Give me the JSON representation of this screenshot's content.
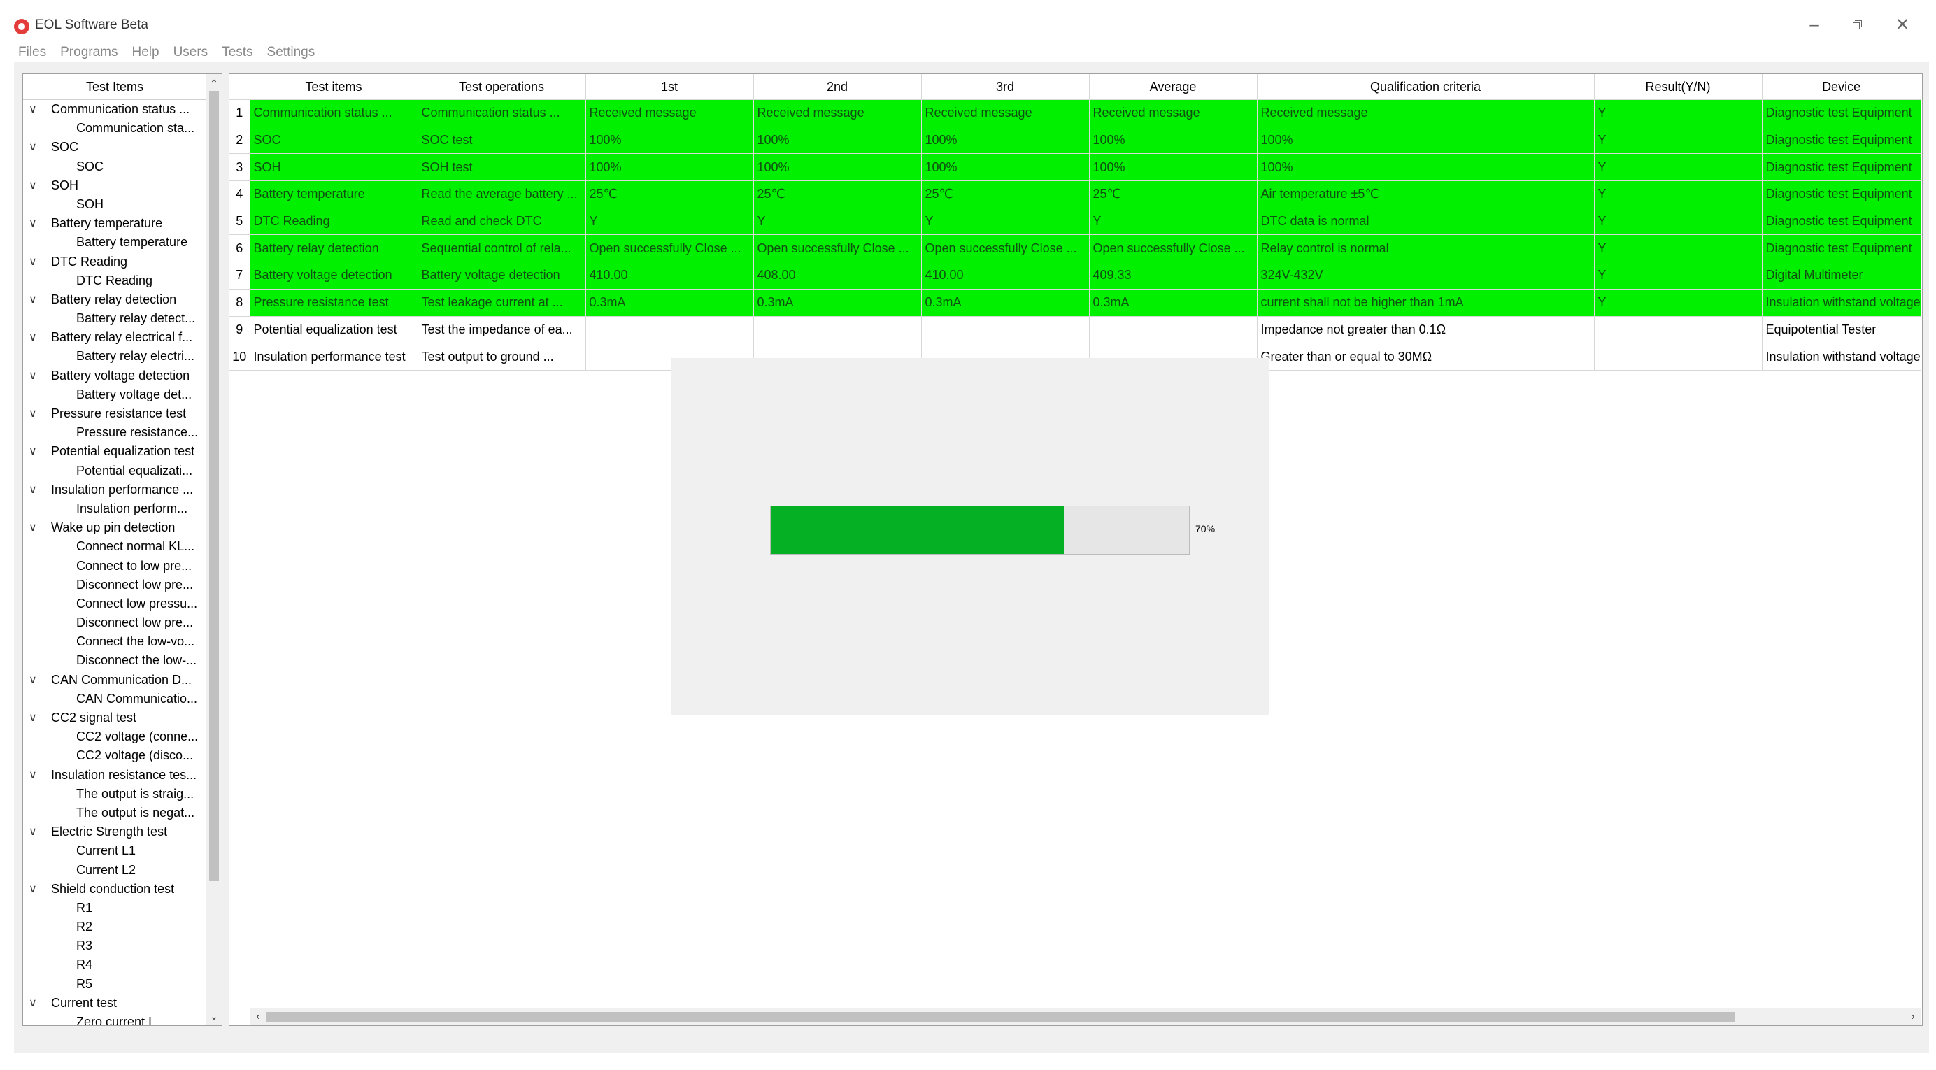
{
  "window": {
    "title": "EOL Software Beta",
    "icon": "app-logo-icon",
    "controls": {
      "minimize": "–",
      "close": "✕"
    }
  },
  "menu": [
    "Files",
    "Programs",
    "Help",
    "Users",
    "Tests",
    "Settings"
  ],
  "tree": {
    "header": "Test Items",
    "rows": [
      {
        "label": "Communication status ...",
        "level": 0
      },
      {
        "label": "Communication sta...",
        "level": 1
      },
      {
        "label": "SOC",
        "level": 0
      },
      {
        "label": "SOC",
        "level": 1
      },
      {
        "label": "SOH",
        "level": 0
      },
      {
        "label": "SOH",
        "level": 1
      },
      {
        "label": "Battery temperature",
        "level": 0
      },
      {
        "label": "Battery temperature",
        "level": 1
      },
      {
        "label": "DTC Reading",
        "level": 0
      },
      {
        "label": "DTC Reading",
        "level": 1
      },
      {
        "label": "Battery relay detection",
        "level": 0
      },
      {
        "label": "Battery relay detect...",
        "level": 1
      },
      {
        "label": "Battery relay electrical f...",
        "level": 0
      },
      {
        "label": "Battery relay electri...",
        "level": 1
      },
      {
        "label": "Battery voltage detection",
        "level": 0
      },
      {
        "label": "Battery voltage det...",
        "level": 1
      },
      {
        "label": "Pressure resistance test",
        "level": 0
      },
      {
        "label": "Pressure resistance...",
        "level": 1
      },
      {
        "label": "Potential equalization test",
        "level": 0
      },
      {
        "label": "Potential equalizati...",
        "level": 1
      },
      {
        "label": "Insulation performance ...",
        "level": 0
      },
      {
        "label": "Insulation perform...",
        "level": 1
      },
      {
        "label": "Wake up pin detection",
        "level": 0
      },
      {
        "label": "Connect normal KL...",
        "level": 1
      },
      {
        "label": "Connect to low pre...",
        "level": 1
      },
      {
        "label": "Disconnect low pre...",
        "level": 1
      },
      {
        "label": "Connect low pressu...",
        "level": 1
      },
      {
        "label": "Disconnect low pre...",
        "level": 1
      },
      {
        "label": "Connect the low-vo...",
        "level": 1
      },
      {
        "label": "Disconnect the low-...",
        "level": 1
      },
      {
        "label": "CAN Communication D...",
        "level": 0
      },
      {
        "label": "CAN Communicatio...",
        "level": 1
      },
      {
        "label": "CC2 signal test",
        "level": 0
      },
      {
        "label": "CC2 voltage (conne...",
        "level": 1
      },
      {
        "label": "CC2 voltage (disco...",
        "level": 1
      },
      {
        "label": "Insulation resistance tes...",
        "level": 0
      },
      {
        "label": "The output is straig...",
        "level": 1
      },
      {
        "label": "The output is negat...",
        "level": 1
      },
      {
        "label": "Electric Strength test",
        "level": 0
      },
      {
        "label": "Current L1",
        "level": 1
      },
      {
        "label": "Current L2",
        "level": 1
      },
      {
        "label": "Shield conduction test",
        "level": 0
      },
      {
        "label": "R1",
        "level": 1
      },
      {
        "label": "R2",
        "level": 1
      },
      {
        "label": "R3",
        "level": 1
      },
      {
        "label": "R4",
        "level": 1
      },
      {
        "label": "R5",
        "level": 1
      },
      {
        "label": "Current test",
        "level": 0
      },
      {
        "label": "Zero current I",
        "level": 1
      }
    ]
  },
  "table": {
    "columns": [
      "Test items",
      "Test operations",
      "1st",
      "2nd",
      "3rd",
      "Average",
      "Qualification criteria",
      "Result(Y/N)",
      "Device"
    ],
    "rows": [
      {
        "n": "1",
        "pass": true,
        "cells": [
          "Communication status ...",
          "Communication status ...",
          "Received message",
          "Received message",
          "Received message",
          "Received message",
          "Received message",
          "Y",
          "Diagnostic test Equipment"
        ]
      },
      {
        "n": "2",
        "pass": true,
        "cells": [
          "SOC",
          "SOC test",
          "100%",
          "100%",
          "100%",
          "100%",
          "100%",
          "Y",
          "Diagnostic test Equipment"
        ]
      },
      {
        "n": "3",
        "pass": true,
        "cells": [
          "SOH",
          "SOH test",
          "100%",
          "100%",
          "100%",
          "100%",
          "100%",
          "Y",
          "Diagnostic test Equipment"
        ]
      },
      {
        "n": "4",
        "pass": true,
        "cells": [
          "Battery temperature",
          "Read the average battery ...",
          "25℃",
          "25℃",
          "25℃",
          "25℃",
          "Air temperature ±5℃",
          "Y",
          "Diagnostic test Equipment"
        ]
      },
      {
        "n": "5",
        "pass": true,
        "cells": [
          "DTC Reading",
          "Read and check DTC",
          "Y",
          "Y",
          "Y",
          "Y",
          "DTC data is normal",
          "Y",
          "Diagnostic test Equipment"
        ]
      },
      {
        "n": "6",
        "pass": true,
        "cells": [
          "Battery relay detection",
          "Sequential control of rela...",
          "Open successfully Close ...",
          "Open successfully Close ...",
          "Open successfully Close ...",
          "Open successfully Close ...",
          "Relay control is normal",
          "Y",
          "Diagnostic test Equipment"
        ]
      },
      {
        "n": "7",
        "pass": true,
        "cells": [
          "Battery voltage detection",
          "Battery voltage detection",
          "410.00",
          "408.00",
          "410.00",
          "409.33",
          "324V-432V",
          "Y",
          "Digital Multimeter"
        ]
      },
      {
        "n": "8",
        "pass": true,
        "cells": [
          "Pressure resistance test",
          "Test leakage current at ...",
          "0.3mA",
          "0.3mA",
          "0.3mA",
          "0.3mA",
          "current shall not be higher than 1mA",
          "Y",
          "Insulation withstand voltage"
        ]
      },
      {
        "n": "9",
        "pass": false,
        "cells": [
          "Potential equalization test",
          "Test the impedance of ea...",
          "",
          "",
          "",
          "",
          "Impedance not greater than 0.1Ω",
          "",
          "Equipotential Tester"
        ]
      },
      {
        "n": "10",
        "pass": false,
        "cells": [
          "Insulation performance test",
          "Test output to ground ...",
          "",
          "",
          "",
          "",
          "Greater than or equal to 30MΩ",
          "",
          "Insulation withstand voltage"
        ]
      }
    ]
  },
  "progress": {
    "value": 0.7,
    "label": "70%",
    "color": "#06b025"
  },
  "colors": {
    "pass_row": "#00f000",
    "accent": "#e43b3b"
  }
}
